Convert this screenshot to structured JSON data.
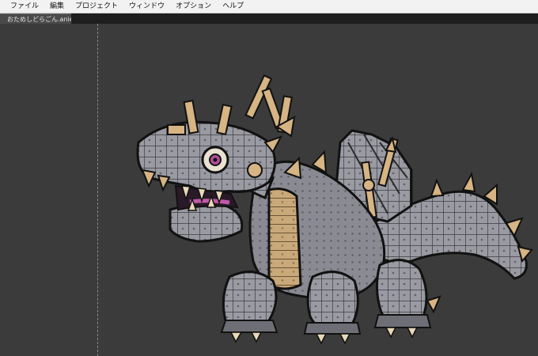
{
  "menubar": {
    "items": [
      "ファイル",
      "編集",
      "プロジェクト",
      "ウィンドウ",
      "オプション",
      "ヘルプ"
    ]
  },
  "tabs": {
    "active_label": "おためしどらごん.anie"
  },
  "colors": {
    "canvas_bg": "#3b3b3b",
    "menubar_bg": "#f2f2f2",
    "tabstrip_bg": "#1e1e1e",
    "tab_active_bg": "#4a4a4a"
  }
}
